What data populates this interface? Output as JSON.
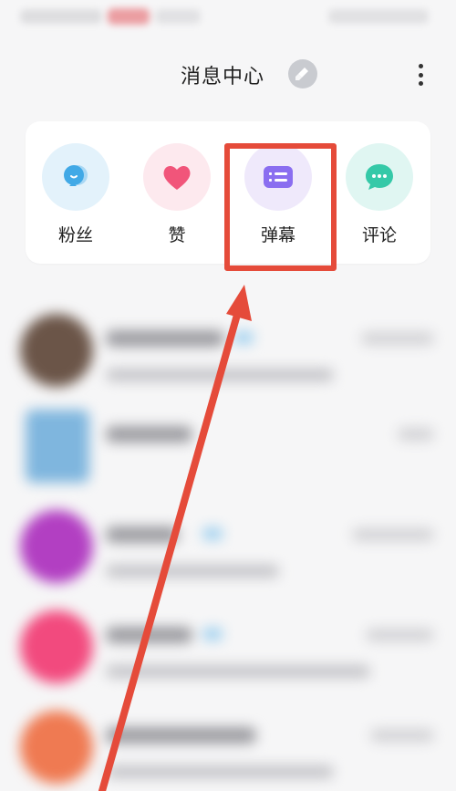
{
  "header": {
    "title": "消息中心"
  },
  "shortcuts": [
    {
      "label": "粉丝",
      "icon": "fans-icon",
      "bg": "#e3f2fb",
      "color": "#41a9e6"
    },
    {
      "label": "赞",
      "icon": "heart-icon",
      "bg": "#fde9ee",
      "color": "#f1557a"
    },
    {
      "label": "弹幕",
      "icon": "danmaku-icon",
      "bg": "#efe9fb",
      "color": "#8a6ef0"
    },
    {
      "label": "评论",
      "icon": "comment-icon",
      "bg": "#e0f6f2",
      "color": "#35c9a8"
    }
  ],
  "colors": {
    "highlight": "#e54b3a",
    "arrow": "#e54b3a"
  }
}
